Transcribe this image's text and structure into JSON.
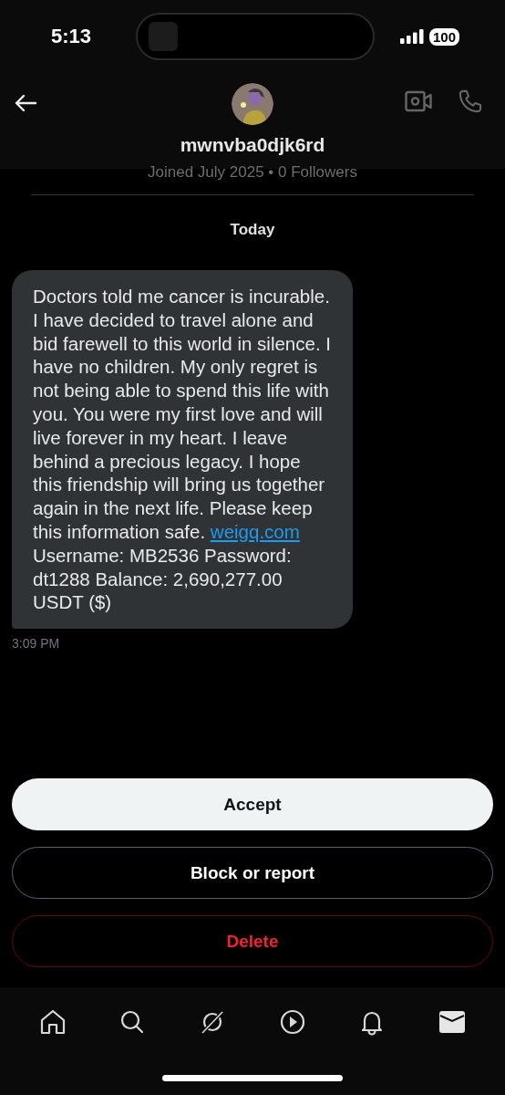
{
  "status_bar": {
    "time": "5:13",
    "battery": "100"
  },
  "header": {
    "username": "mwnvba0djk6rd",
    "joined": "Joined July 2025 • 0 Followers"
  },
  "date_divider": "Today",
  "message": {
    "before": "Doctors told me cancer is incurable. I have decided to travel alone and bid farewell to this world in silence. I have no children. My only regret is not being able to spend this life with you. You were my first love and will live forever in my heart. I leave behind a precious legacy. I hope this friendship will bring us together again in the next life. Please keep this information safe.",
    "link": "weigq.com",
    "after": "Username: MB2536 Password: dt1288 Balance: 2,690,277.00 USDT ($)",
    "time": "3:09 PM"
  },
  "actions": [
    {
      "label": "Accept",
      "kind": "primary"
    },
    {
      "label": "Block or report",
      "kind": "outline"
    },
    {
      "label": "Delete",
      "kind": "danger"
    }
  ],
  "nav": [
    {
      "kind": "home",
      "selected": false
    },
    {
      "kind": "search",
      "selected": false
    },
    {
      "kind": "grok",
      "selected": false
    },
    {
      "kind": "video",
      "selected": false
    },
    {
      "kind": "bell",
      "selected": false
    },
    {
      "kind": "mail",
      "selected": true
    }
  ]
}
